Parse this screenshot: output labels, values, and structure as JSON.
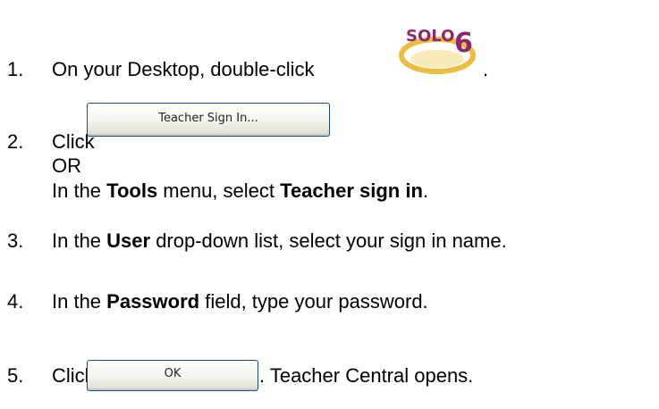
{
  "steps": {
    "s1": {
      "num": "1.",
      "text": "On your Desktop, double-click",
      "after": "."
    },
    "s2": {
      "num": "2.",
      "click": "Click",
      "button_label": "Teacher Sign In...",
      "or": "OR",
      "alt_pre": "In the ",
      "alt_b1": "Tools",
      "alt_mid": " menu, select ",
      "alt_b2": "Teacher sign in",
      "alt_post": "."
    },
    "s3": {
      "num": "3.",
      "pre": "In the ",
      "bold": "User",
      "post": " drop-down list, select your sign in name."
    },
    "s4": {
      "num": "4.",
      "pre": "In the ",
      "bold": "Password",
      "post": " field, type your password."
    },
    "s5": {
      "num": "5.",
      "click": "Click",
      "button_label": "OK",
      "after": ". Teacher Central opens."
    }
  },
  "logo": {
    "text": "SOLO",
    "digit": "6",
    "icon": "solo6-logo-icon",
    "color_text": "#8a2a6e",
    "color_swoosh": "#e8b21e"
  }
}
